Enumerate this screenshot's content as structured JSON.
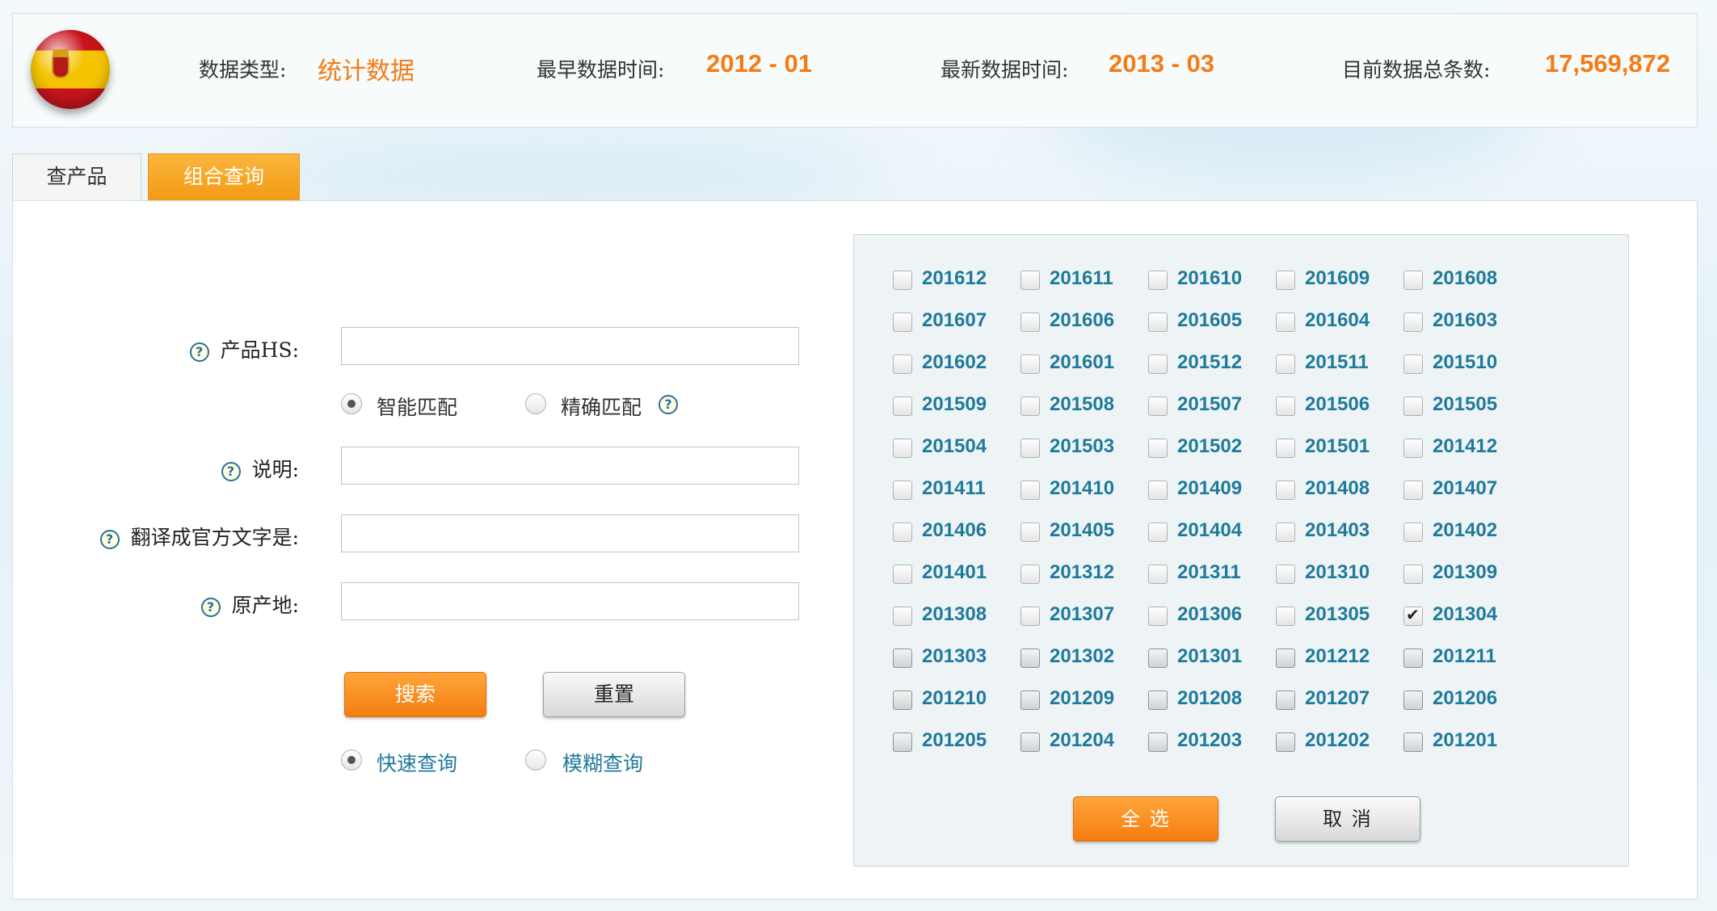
{
  "header": {
    "data_type_label": "数据类型:",
    "data_type_value": "统计数据",
    "earliest_label": "最早数据时间:",
    "earliest_value": "2012 - 01",
    "latest_label": "最新数据时间:",
    "latest_value": "2013 - 03",
    "total_label": "目前数据总条数:",
    "total_value": "17,569,872",
    "flag_icon": "spain-flag-icon"
  },
  "tabs": [
    {
      "label": "查产品",
      "active": false
    },
    {
      "label": "组合查询",
      "active": true
    }
  ],
  "form": {
    "hs_label": "产品HS:",
    "hs_value": "",
    "match_options": [
      {
        "label": "智能匹配",
        "selected": true
      },
      {
        "label": "精确匹配",
        "selected": false
      }
    ],
    "desc_label": "说明:",
    "desc_value": "",
    "translate_label": "翻译成官方文字是:",
    "translate_value": "",
    "origin_label": "原产地:",
    "origin_value": "",
    "search_button": "搜索",
    "reset_button": "重置",
    "query_modes": [
      {
        "label": "快速查询",
        "selected": true
      },
      {
        "label": "模糊查询",
        "selected": false
      }
    ],
    "help_icon": "question-help-icon"
  },
  "dates": {
    "items": [
      {
        "label": "201612",
        "checked": false,
        "dark": false
      },
      {
        "label": "201611",
        "checked": false,
        "dark": false
      },
      {
        "label": "201610",
        "checked": false,
        "dark": false
      },
      {
        "label": "201609",
        "checked": false,
        "dark": false
      },
      {
        "label": "201608",
        "checked": false,
        "dark": false
      },
      {
        "label": "201607",
        "checked": false,
        "dark": false
      },
      {
        "label": "201606",
        "checked": false,
        "dark": false
      },
      {
        "label": "201605",
        "checked": false,
        "dark": false
      },
      {
        "label": "201604",
        "checked": false,
        "dark": false
      },
      {
        "label": "201603",
        "checked": false,
        "dark": false
      },
      {
        "label": "201602",
        "checked": false,
        "dark": false
      },
      {
        "label": "201601",
        "checked": false,
        "dark": false
      },
      {
        "label": "201512",
        "checked": false,
        "dark": false
      },
      {
        "label": "201511",
        "checked": false,
        "dark": false
      },
      {
        "label": "201510",
        "checked": false,
        "dark": false
      },
      {
        "label": "201509",
        "checked": false,
        "dark": false
      },
      {
        "label": "201508",
        "checked": false,
        "dark": false
      },
      {
        "label": "201507",
        "checked": false,
        "dark": false
      },
      {
        "label": "201506",
        "checked": false,
        "dark": false
      },
      {
        "label": "201505",
        "checked": false,
        "dark": false
      },
      {
        "label": "201504",
        "checked": false,
        "dark": false
      },
      {
        "label": "201503",
        "checked": false,
        "dark": false
      },
      {
        "label": "201502",
        "checked": false,
        "dark": false
      },
      {
        "label": "201501",
        "checked": false,
        "dark": false
      },
      {
        "label": "201412",
        "checked": false,
        "dark": false
      },
      {
        "label": "201411",
        "checked": false,
        "dark": false
      },
      {
        "label": "201410",
        "checked": false,
        "dark": false
      },
      {
        "label": "201409",
        "checked": false,
        "dark": false
      },
      {
        "label": "201408",
        "checked": false,
        "dark": false
      },
      {
        "label": "201407",
        "checked": false,
        "dark": false
      },
      {
        "label": "201406",
        "checked": false,
        "dark": false
      },
      {
        "label": "201405",
        "checked": false,
        "dark": false
      },
      {
        "label": "201404",
        "checked": false,
        "dark": false
      },
      {
        "label": "201403",
        "checked": false,
        "dark": false
      },
      {
        "label": "201402",
        "checked": false,
        "dark": false
      },
      {
        "label": "201401",
        "checked": false,
        "dark": false
      },
      {
        "label": "201312",
        "checked": false,
        "dark": false
      },
      {
        "label": "201311",
        "checked": false,
        "dark": false
      },
      {
        "label": "201310",
        "checked": false,
        "dark": false
      },
      {
        "label": "201309",
        "checked": false,
        "dark": false
      },
      {
        "label": "201308",
        "checked": false,
        "dark": false
      },
      {
        "label": "201307",
        "checked": false,
        "dark": false
      },
      {
        "label": "201306",
        "checked": false,
        "dark": false
      },
      {
        "label": "201305",
        "checked": false,
        "dark": false
      },
      {
        "label": "201304",
        "checked": true,
        "dark": false
      },
      {
        "label": "201303",
        "checked": false,
        "dark": true
      },
      {
        "label": "201302",
        "checked": false,
        "dark": true
      },
      {
        "label": "201301",
        "checked": false,
        "dark": true
      },
      {
        "label": "201212",
        "checked": false,
        "dark": true
      },
      {
        "label": "201211",
        "checked": false,
        "dark": true
      },
      {
        "label": "201210",
        "checked": false,
        "dark": true
      },
      {
        "label": "201209",
        "checked": false,
        "dark": true
      },
      {
        "label": "201208",
        "checked": false,
        "dark": true
      },
      {
        "label": "201207",
        "checked": false,
        "dark": true
      },
      {
        "label": "201206",
        "checked": false,
        "dark": true
      },
      {
        "label": "201205",
        "checked": false,
        "dark": true
      },
      {
        "label": "201204",
        "checked": false,
        "dark": true
      },
      {
        "label": "201203",
        "checked": false,
        "dark": true
      },
      {
        "label": "201202",
        "checked": false,
        "dark": true
      },
      {
        "label": "201201",
        "checked": false,
        "dark": true
      }
    ],
    "select_all_button": "全 选",
    "cancel_button": "取 消"
  },
  "colors": {
    "accent_orange": "#f57b14",
    "date_label_blue": "#1f7a9a"
  }
}
